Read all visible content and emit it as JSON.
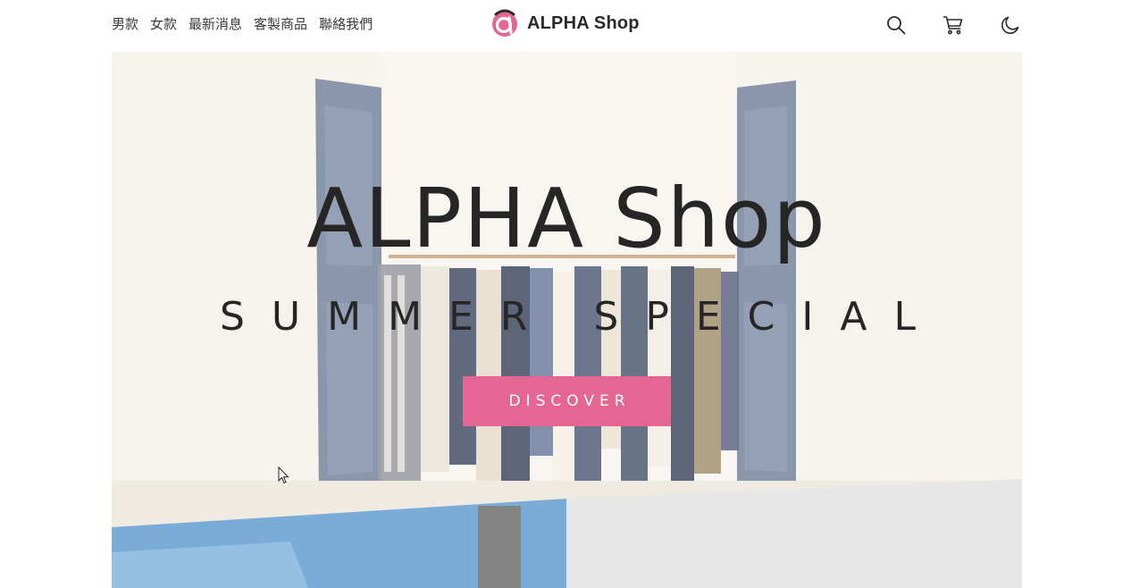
{
  "header": {
    "nav": [
      {
        "label": "男款"
      },
      {
        "label": "女款"
      },
      {
        "label": "最新消息"
      },
      {
        "label": "客製商品"
      },
      {
        "label": "聯絡我們"
      }
    ],
    "brand_name": "ALPHA Shop",
    "icons": [
      "search-icon",
      "cart-icon",
      "moon-icon"
    ]
  },
  "hero": {
    "title": "ALPHA Shop",
    "subtitle": "SUMMER SPECIAL",
    "cta_label": "DISCOVER"
  },
  "colors": {
    "accent": "#e56593",
    "text": "#2a2a2a",
    "hero_bg": "#f1ece5",
    "sky": "#5c9bd0",
    "panel_grey": "#e2e2e2"
  }
}
